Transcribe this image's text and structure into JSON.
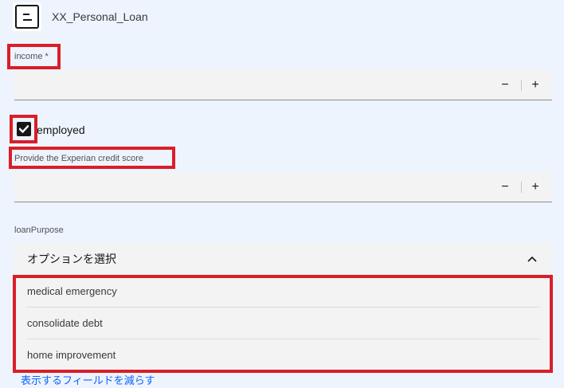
{
  "header": {
    "title": "XX_Personal_Loan",
    "icon": "form-icon"
  },
  "income": {
    "label": "income *",
    "value": "",
    "decrement": "−",
    "increment": "+"
  },
  "employed": {
    "label": "employed",
    "checked": true
  },
  "credit_score": {
    "label": "Provide the Experian credit score",
    "value": "",
    "decrement": "−",
    "increment": "+"
  },
  "loan_purpose": {
    "label": "loanPurpose",
    "placeholder": "オプションを選択",
    "options": [
      "medical emergency",
      "consolidate debt",
      "home improvement"
    ]
  },
  "footer": {
    "show_less_link": "表示するフィールドを減らす"
  },
  "colors": {
    "highlight": "#da1e28",
    "link": "#0f62fe",
    "background": "#edf4fe",
    "field": "#f3f3f3"
  }
}
